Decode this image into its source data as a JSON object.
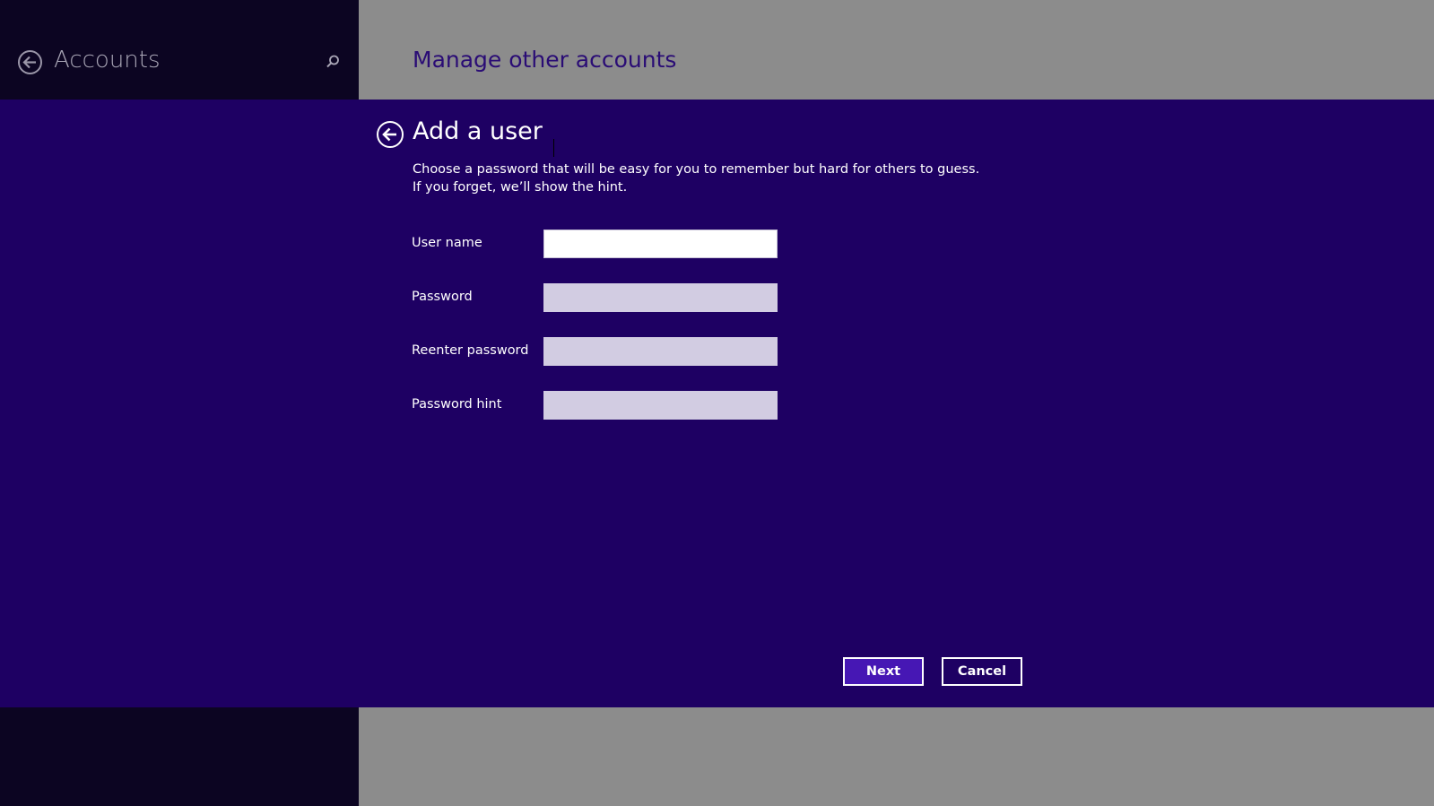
{
  "left_pane": {
    "title": "Accounts",
    "back_icon": "back-arrow-icon",
    "search_icon": "search-icon"
  },
  "header": {
    "title": "Manage other accounts"
  },
  "dialog": {
    "title": "Add a user",
    "description": "Choose a password that will be easy for you to remember but hard for others to guess. If you forget, we’ll show the hint.",
    "fields": [
      {
        "label": "User name",
        "value": "",
        "placeholder": ""
      },
      {
        "label": "Password",
        "value": "",
        "placeholder": ""
      },
      {
        "label": "Reenter password",
        "value": "",
        "placeholder": ""
      },
      {
        "label": "Password hint",
        "value": "",
        "placeholder": ""
      }
    ],
    "buttons": {
      "next_label": "Next",
      "cancel_label": "Cancel"
    }
  },
  "colors": {
    "dialog_background": "#1e0063",
    "accent_button": "#4617b4",
    "sidebar_background": "#0c0522",
    "header_background": "#8c8c8c",
    "header_title": "#2a0c75"
  }
}
